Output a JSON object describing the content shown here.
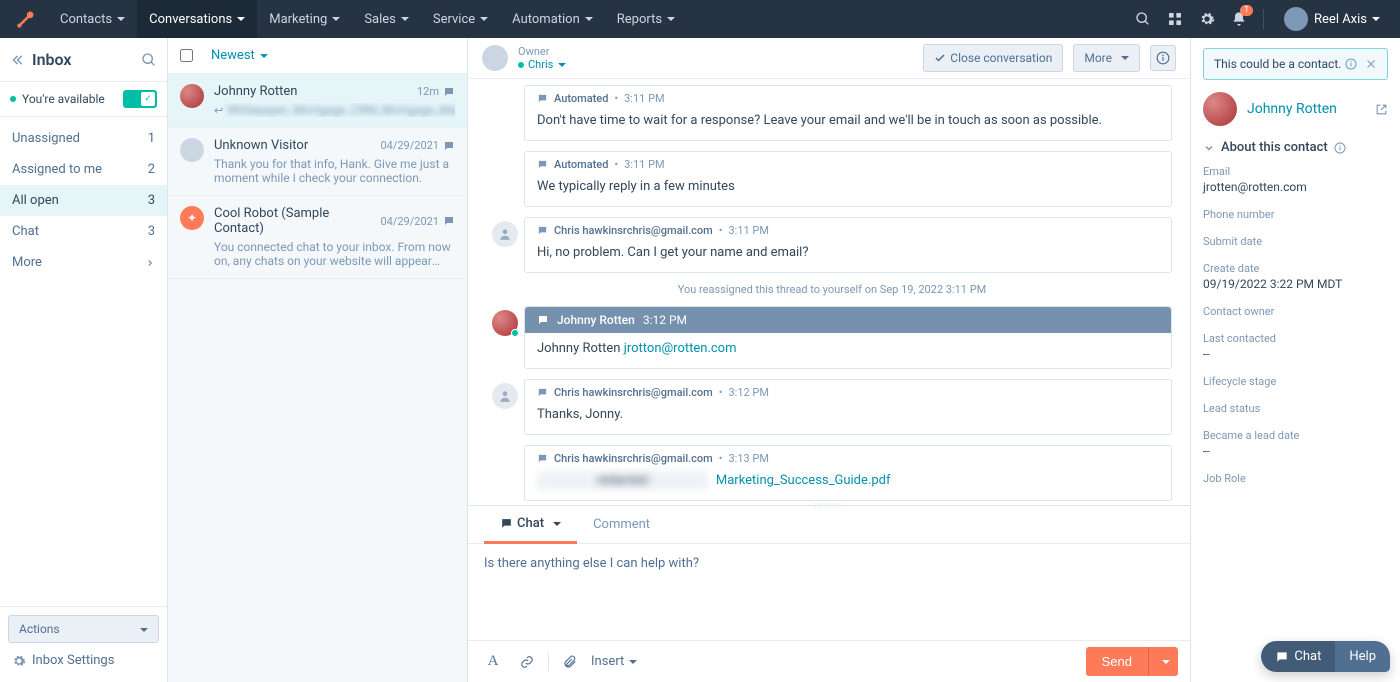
{
  "topnav": {
    "items": [
      "Contacts",
      "Conversations",
      "Marketing",
      "Sales",
      "Service",
      "Automation",
      "Reports"
    ],
    "active_index": 1,
    "notif_count": "1",
    "user_name": "Reel Axis"
  },
  "sidebar": {
    "title": "Inbox",
    "availability": "You're available",
    "folders": [
      {
        "label": "Unassigned",
        "count": "1",
        "active": false
      },
      {
        "label": "Assigned to me",
        "count": "2",
        "active": false
      },
      {
        "label": "All open",
        "count": "3",
        "active": true
      },
      {
        "label": "Chat",
        "count": "3",
        "active": false
      },
      {
        "label": "More",
        "count": "",
        "chevron": true,
        "active": false
      }
    ],
    "actions_label": "Actions",
    "settings_label": "Inbox Settings"
  },
  "convo_list": {
    "sort": "Newest",
    "items": [
      {
        "name": "Johnny Rotten",
        "time": "12m",
        "preview_prefix": "↩",
        "preview": "Whitepaper_Mortgage_CRM_Mortgage_Marketin",
        "avatar": "jr",
        "selected": true,
        "blurred": true
      },
      {
        "name": "Unknown Visitor",
        "time": "04/29/2021",
        "preview": "Thank you for that info, Hank. Give me just a moment while I check your connection.",
        "avatar": "generic"
      },
      {
        "name": "Cool Robot (Sample Contact)",
        "time": "04/29/2021",
        "preview": "You connected chat to your inbox. From now on, any chats on your website will appear here. Choose wha...",
        "avatar": "robot"
      }
    ]
  },
  "thread": {
    "owner_label": "Owner",
    "owner_name": "Chris",
    "close_btn": "Close conversation",
    "more_btn": "More",
    "messages": [
      {
        "kind": "msg",
        "sender": "Automated",
        "time": "3:11 PM",
        "body": "Don't have time to wait for a response? Leave your email and we'll be in touch as soon as possible."
      },
      {
        "kind": "msg",
        "sender": "Automated",
        "time": "3:11 PM",
        "body": "We typically reply in a few minutes"
      },
      {
        "kind": "msg",
        "sender": "Chris hawkinsrchris@gmail.com",
        "time": "3:11 PM",
        "body": "Hi, no problem. Can I get your name and email?",
        "avatar": "generic"
      },
      {
        "kind": "sys",
        "body": "You reassigned this thread to yourself on Sep 19, 2022 3:11 PM"
      },
      {
        "kind": "highlight",
        "sender": "Johnny Rotten",
        "time": "3:12 PM",
        "body": "Johnny Rotten  ",
        "link": "jrotton@rotten.com",
        "avatar": "jr"
      },
      {
        "kind": "msg",
        "sender": "Chris hawkinsrchris@gmail.com",
        "time": "3:12 PM",
        "body": "Thanks, Jonny.",
        "avatar": "generic"
      },
      {
        "kind": "msg",
        "sender": "Chris hawkinsrchris@gmail.com",
        "time": "3:13 PM",
        "body": "",
        "link": "Marketing_Success_Guide.pdf",
        "blurred": true
      }
    ]
  },
  "composer": {
    "tabs": [
      "Chat",
      "Comment"
    ],
    "text": "Is there anything else I can help with?",
    "insert_label": "Insert",
    "send_label": "Send"
  },
  "rpanel": {
    "alert": "This could be a contact.",
    "contact_name": "Johnny Rotten",
    "section": "About this contact",
    "fields": [
      {
        "lbl": "Email",
        "val": "jrotten@rotten.com"
      },
      {
        "lbl": "Phone number",
        "val": ""
      },
      {
        "lbl": "Submit date",
        "val": ""
      },
      {
        "lbl": "Create date",
        "val": "09/19/2022 3:22 PM MDT"
      },
      {
        "lbl": "Contact owner",
        "val": ""
      },
      {
        "lbl": "Last contacted",
        "val": "--"
      },
      {
        "lbl": "Lifecycle stage",
        "val": ""
      },
      {
        "lbl": "Lead status",
        "val": ""
      },
      {
        "lbl": "Became a lead date",
        "val": "--"
      },
      {
        "lbl": "Job Role",
        "val": ""
      }
    ]
  },
  "float_help": {
    "chat": "Chat",
    "help": "Help"
  }
}
